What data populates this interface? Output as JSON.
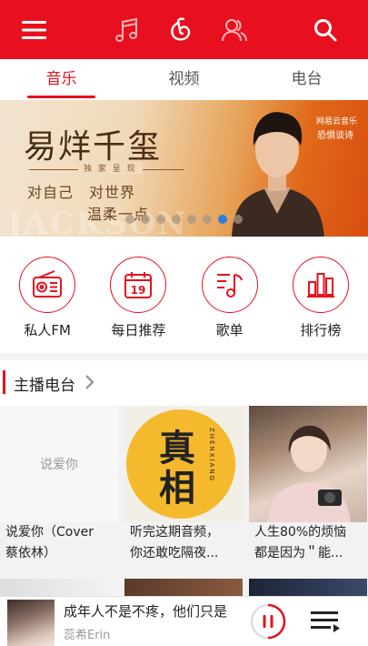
{
  "header": {
    "icons": [
      "menu-icon",
      "music-note-icon",
      "netease-icon",
      "friends-icon",
      "search-icon"
    ]
  },
  "tabs": [
    {
      "label": "音乐",
      "active": true
    },
    {
      "label": "视频",
      "active": false
    },
    {
      "label": "电台",
      "active": false
    }
  ],
  "banner": {
    "title": "易烊千玺",
    "exclusive": "独 家 呈 现",
    "line1": "对自己　对世界",
    "line2": "温柔一点",
    "brand": "网易云音乐",
    "subtitle": "恐惧谈诗",
    "background_word": "JACKSON",
    "slide_count": 8,
    "active_slide": 6
  },
  "entries": [
    {
      "label": "私人FM",
      "icon": "radio-icon"
    },
    {
      "label": "每日推荐",
      "icon": "calendar-icon",
      "day": "19"
    },
    {
      "label": "歌单",
      "icon": "playlist-icon"
    },
    {
      "label": "排行榜",
      "icon": "ranking-icon"
    }
  ],
  "section": {
    "title": "主播电台"
  },
  "cards": [
    {
      "cover_text": "说爱你",
      "caption_1": "说爱你（Cover",
      "caption_2": "蔡依林）"
    },
    {
      "cover_big_1": "真",
      "cover_big_2": "相",
      "cover_side": "ZHENXIANG",
      "caption_1": "听完这期音频，",
      "caption_2": "你还敢吃隔夜..."
    },
    {
      "caption_1": "人生80%的烦恼",
      "caption_2": "都是因为＂能..."
    }
  ],
  "player": {
    "song": "成年人不是不疼，他们只是",
    "artist": "蕊希Erin",
    "state": "playing"
  },
  "colors": {
    "accent": "#e8101e",
    "background": "#f2f2f2"
  }
}
